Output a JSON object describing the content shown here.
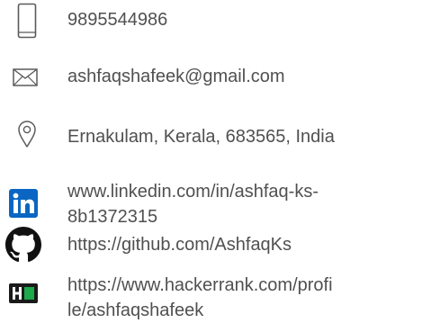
{
  "contact": {
    "phone": {
      "icon": "mobile-phone-icon",
      "text": "9895544986"
    },
    "email": {
      "icon": "envelope-icon",
      "text": "ashfaqshafeek@gmail.com"
    },
    "location": {
      "icon": "map-pin-icon",
      "text": "Ernakulam, Kerala, 683565, India"
    },
    "linkedin": {
      "icon": "linkedin-icon",
      "line1": "www.linkedin.com/in/ashfaq-ks-",
      "line2": "8b1372315"
    },
    "github": {
      "icon": "github-icon",
      "text": "https://github.com/AshfaqKs"
    },
    "hackerrank": {
      "icon": "hackerrank-icon",
      "line1": "https://www.hackerrank.com/profi",
      "line2": "le/ashfaqshafeek"
    }
  },
  "colors": {
    "text": "#505050",
    "icon_outline": "#5a5a5a",
    "linkedin_blue": "#0a66c2",
    "github_black": "#111111",
    "hackerrank_green": "#1ba94c",
    "hackerrank_bg": "#1a1a1a"
  }
}
